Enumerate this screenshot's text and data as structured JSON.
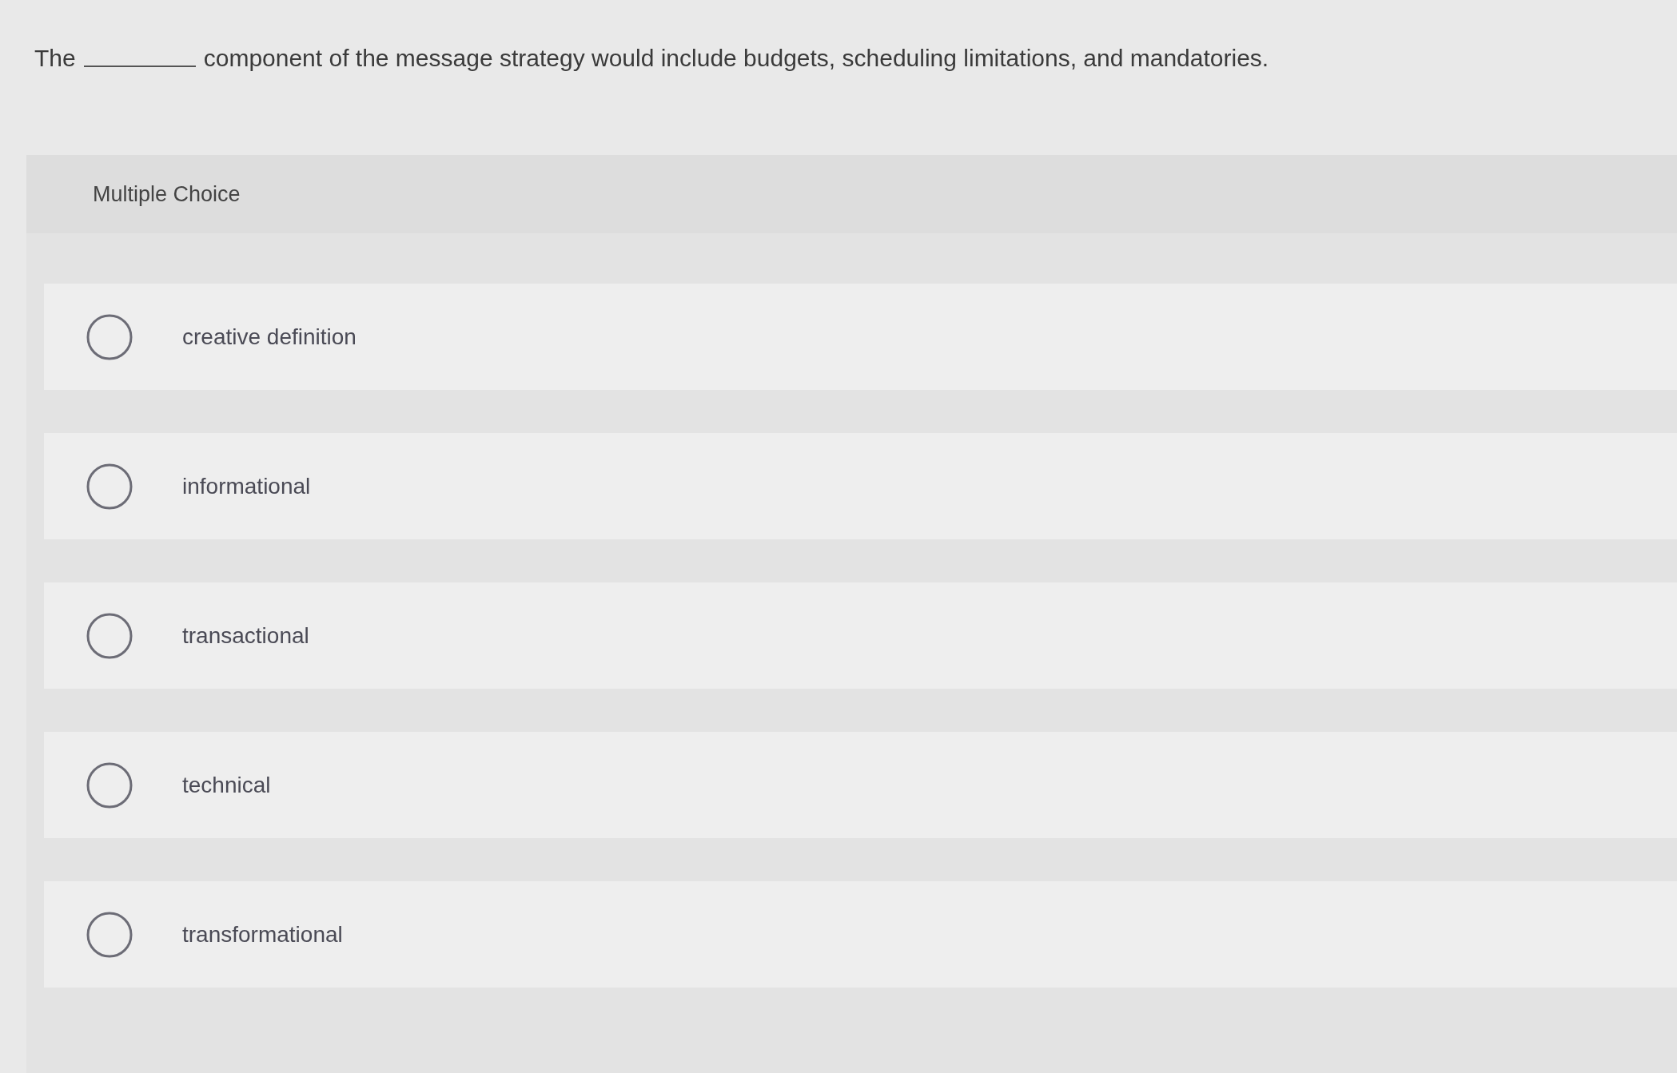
{
  "question": {
    "before_blank": "The",
    "after_blank": "component of the message strategy would include budgets, scheduling limitations, and mandatories."
  },
  "section": {
    "title": "Multiple Choice"
  },
  "options": [
    {
      "label": "creative definition",
      "selected": false
    },
    {
      "label": "informational",
      "selected": false
    },
    {
      "label": "transactional",
      "selected": false
    },
    {
      "label": "technical",
      "selected": false
    },
    {
      "label": "transformational",
      "selected": false
    }
  ]
}
